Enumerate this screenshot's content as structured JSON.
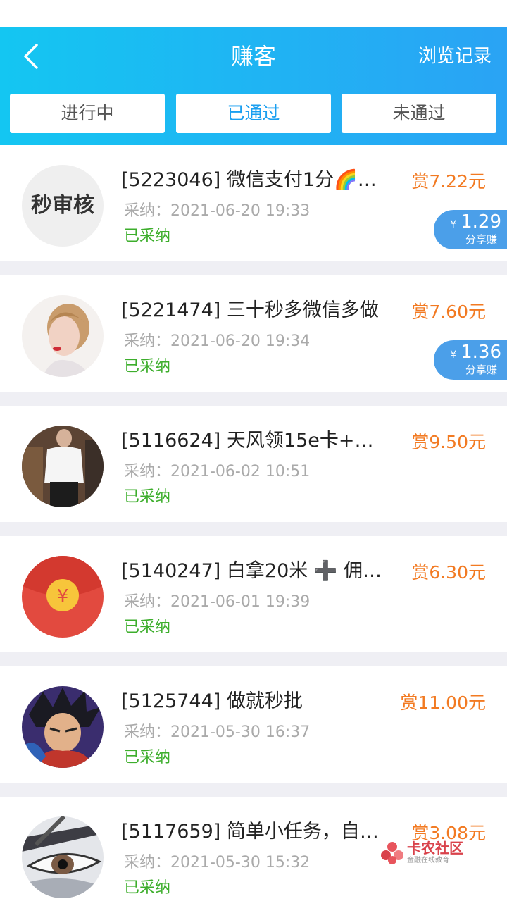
{
  "header": {
    "title": "赚客",
    "history_label": "浏览记录"
  },
  "tabs": [
    {
      "label": "进行中"
    },
    {
      "label": "已通过"
    },
    {
      "label": "未通过"
    }
  ],
  "items": [
    {
      "title": "[5223046] 微信支付1分🌈…",
      "reward": "赏7.22元",
      "meta": "采纳：2021-06-20 19:33",
      "status": "已采纳",
      "share_value": "1.29",
      "share_label": "分享赚",
      "avatar_text": "秒审核"
    },
    {
      "title": "[5221474] 三十秒多微信多做",
      "reward": "赏7.60元",
      "meta": "采纳：2021-06-20 19:34",
      "status": "已采纳",
      "share_value": "1.36",
      "share_label": "分享赚"
    },
    {
      "title": "[5116624] 天风领15e卡+…",
      "reward": "赏9.50元",
      "meta": "采纳：2021-06-02 10:51",
      "status": "已采纳"
    },
    {
      "title": "[5140247] 白拿20米 ➕ 佣…",
      "reward": "赏6.30元",
      "meta": "采纳：2021-06-01 19:39",
      "status": "已采纳"
    },
    {
      "title": "[5125744] 做就秒批",
      "reward": "赏11.00元",
      "meta": "采纳：2021-05-30 16:37",
      "status": "已采纳"
    },
    {
      "title": "[5117659] 简单小任务，自…",
      "reward": "赏3.08元",
      "meta": "采纳：2021-05-30 15:32",
      "status": "已采纳"
    }
  ],
  "share_currency": "¥",
  "watermark": {
    "name": "卡农社区",
    "sub": "金融在线教育"
  }
}
